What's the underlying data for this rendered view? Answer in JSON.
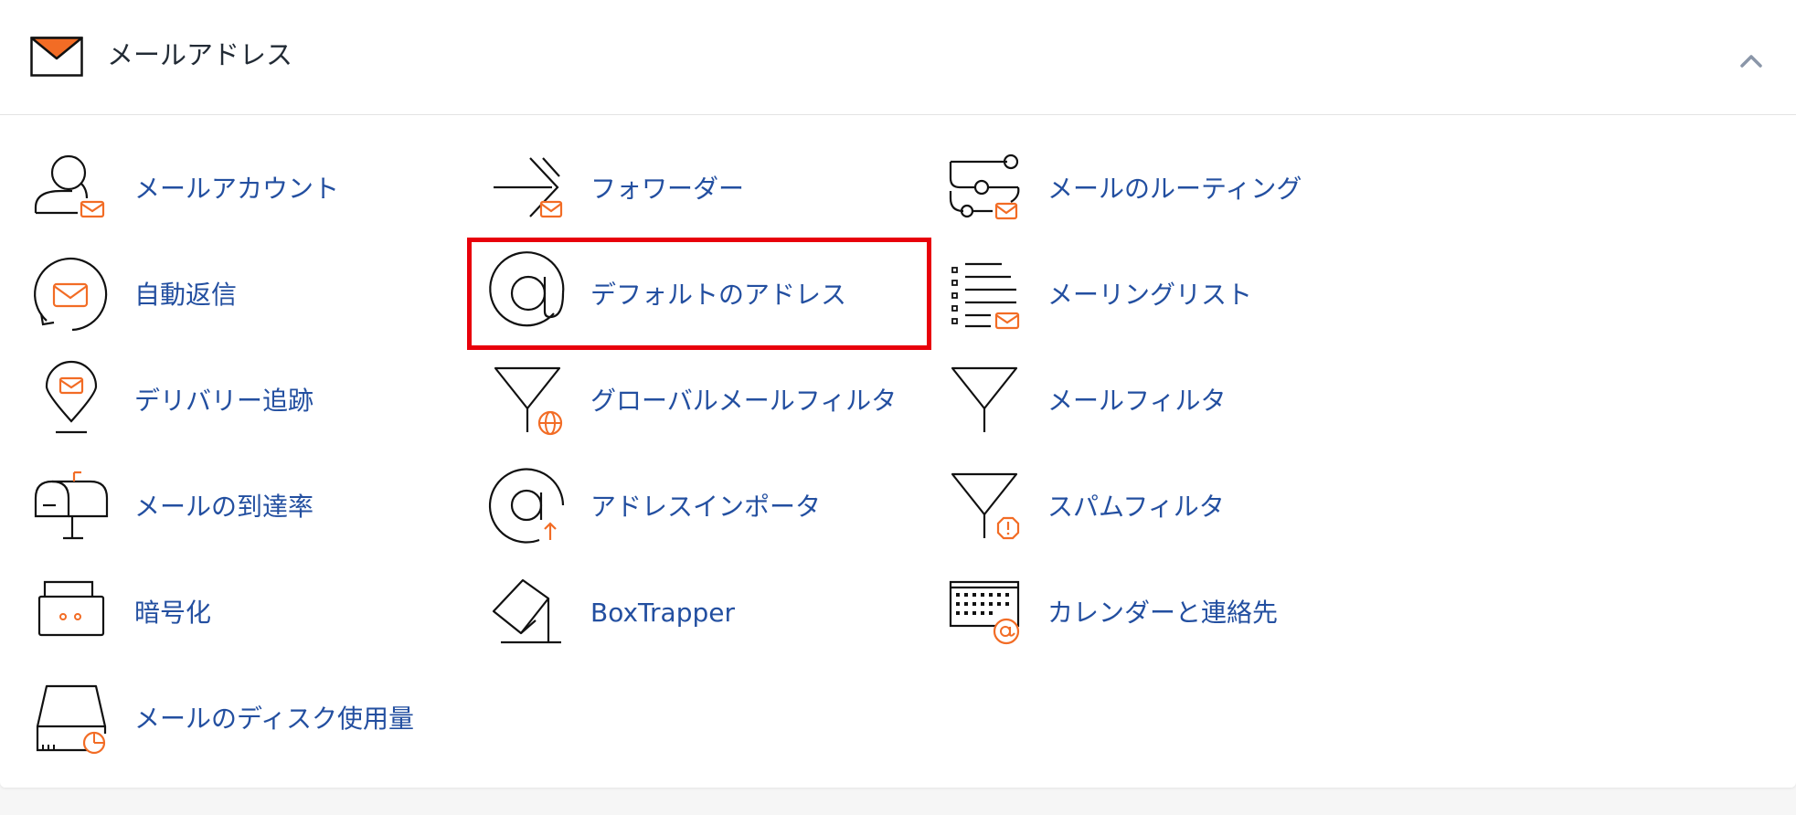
{
  "colors": {
    "accent": "#f26c25",
    "link": "#234fa0",
    "highlight": "#e8000b"
  },
  "section": {
    "title": "メールアドレス",
    "icon": "envelope-icon",
    "collapse_icon": "chevron-up-icon"
  },
  "items": [
    {
      "label": "メールアカウント",
      "icon": "email-accounts-icon"
    },
    {
      "label": "フォワーダー",
      "icon": "forwarders-icon"
    },
    {
      "label": "メールのルーティング",
      "icon": "email-routing-icon"
    },
    {
      "label": "自動返信",
      "icon": "autoresponders-icon"
    },
    {
      "label": "デフォルトのアドレス",
      "icon": "default-address-icon",
      "highlighted": true
    },
    {
      "label": "メーリングリスト",
      "icon": "mailing-lists-icon"
    },
    {
      "label": "デリバリー追跡",
      "icon": "track-delivery-icon"
    },
    {
      "label": "グローバルメールフィルタ",
      "icon": "global-email-filters-icon"
    },
    {
      "label": "メールフィルタ",
      "icon": "email-filters-icon"
    },
    {
      "label": "メールの到達率",
      "icon": "email-deliverability-icon"
    },
    {
      "label": "アドレスインポータ",
      "icon": "address-importer-icon"
    },
    {
      "label": "スパムフィルタ",
      "icon": "spam-filters-icon"
    },
    {
      "label": "暗号化",
      "icon": "encryption-icon"
    },
    {
      "label": "BoxTrapper",
      "icon": "boxtrapper-icon"
    },
    {
      "label": "カレンダーと連絡先",
      "icon": "calendars-contacts-icon"
    },
    {
      "label": "メールのディスク使用量",
      "icon": "email-disk-usage-icon"
    }
  ]
}
